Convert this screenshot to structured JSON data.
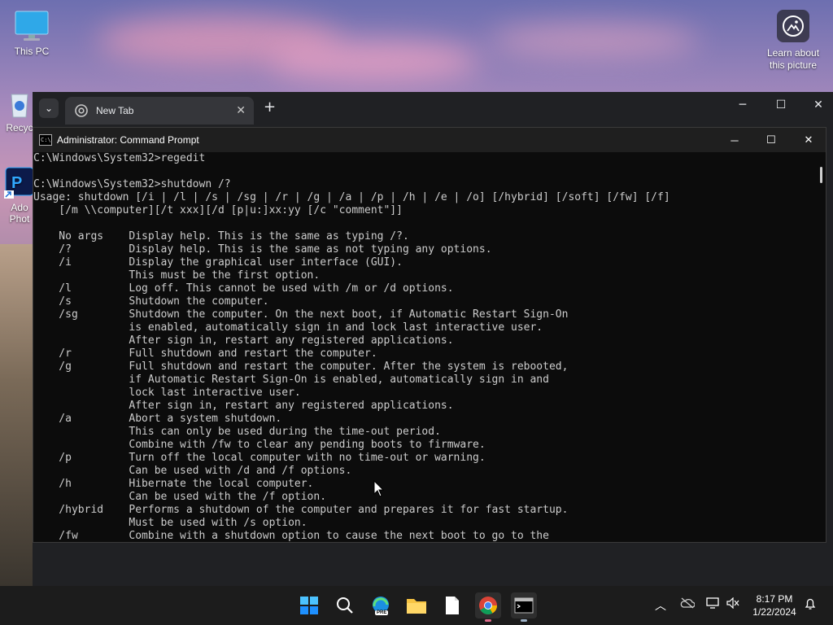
{
  "desktop": {
    "icons": [
      {
        "label": "This PC"
      },
      {
        "label": "Recyc"
      },
      {
        "label": "Ado Phot"
      }
    ],
    "learn_label": "Learn about this picture"
  },
  "chrome": {
    "tab_title": "New Tab"
  },
  "cmd": {
    "title": "Administrator: Command Prompt",
    "lines": [
      "C:\\Windows\\System32>regedit",
      "",
      "C:\\Windows\\System32>shutdown /?",
      "Usage: shutdown [/i | /l | /s | /sg | /r | /g | /a | /p | /h | /e | /o] [/hybrid] [/soft] [/fw] [/f]",
      "    [/m \\\\computer][/t xxx][/d [p|u:]xx:yy [/c \"comment\"]]",
      "",
      "    No args    Display help. This is the same as typing /?.",
      "    /?         Display help. This is the same as not typing any options.",
      "    /i         Display the graphical user interface (GUI).",
      "               This must be the first option.",
      "    /l         Log off. This cannot be used with /m or /d options.",
      "    /s         Shutdown the computer.",
      "    /sg        Shutdown the computer. On the next boot, if Automatic Restart Sign-On",
      "               is enabled, automatically sign in and lock last interactive user.",
      "               After sign in, restart any registered applications.",
      "    /r         Full shutdown and restart the computer.",
      "    /g         Full shutdown and restart the computer. After the system is rebooted,",
      "               if Automatic Restart Sign-On is enabled, automatically sign in and",
      "               lock last interactive user.",
      "               After sign in, restart any registered applications.",
      "    /a         Abort a system shutdown.",
      "               This can only be used during the time-out period.",
      "               Combine with /fw to clear any pending boots to firmware.",
      "    /p         Turn off the local computer with no time-out or warning.",
      "               Can be used with /d and /f options.",
      "    /h         Hibernate the local computer.",
      "               Can be used with the /f option.",
      "    /hybrid    Performs a shutdown of the computer and prepares it for fast startup.",
      "               Must be used with /s option.",
      "    /fw        Combine with a shutdown option to cause the next boot to go to the"
    ]
  },
  "taskbar": {
    "time": "8:17 PM",
    "date": "1/22/2024",
    "edge_badge": "PRE"
  }
}
